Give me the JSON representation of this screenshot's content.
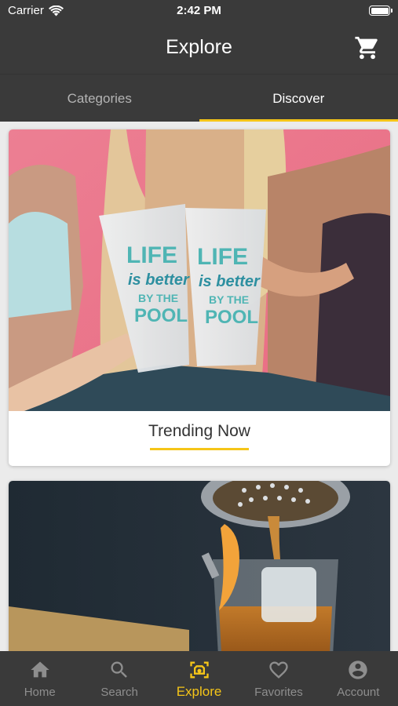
{
  "status_bar": {
    "carrier": "Carrier",
    "time": "2:42 PM",
    "battery_level": 1.0
  },
  "header": {
    "title": "Explore",
    "cart_icon": "shopping-cart-icon"
  },
  "tabs": [
    {
      "label": "Categories",
      "active": false
    },
    {
      "label": "Discover",
      "active": true
    }
  ],
  "cards": [
    {
      "label": "Trending Now",
      "image": "friends toasting frosted cups printed LIFE is better BY THE POOL"
    },
    {
      "label": "",
      "image": "whiskey poured over ice through cocktail strainer with orange peel"
    }
  ],
  "bottom_nav": [
    {
      "label": "Home",
      "icon": "home-icon",
      "active": false
    },
    {
      "label": "Search",
      "icon": "search-icon",
      "active": false
    },
    {
      "label": "Explore",
      "icon": "explore-icon",
      "active": true
    },
    {
      "label": "Favorites",
      "icon": "heart-icon",
      "active": false
    },
    {
      "label": "Account",
      "icon": "account-icon",
      "active": false
    }
  ],
  "colors": {
    "bar_background": "#3a3a3a",
    "accent": "#f5c518",
    "inactive": "#8e8e8e",
    "content_background": "#ebebeb"
  }
}
